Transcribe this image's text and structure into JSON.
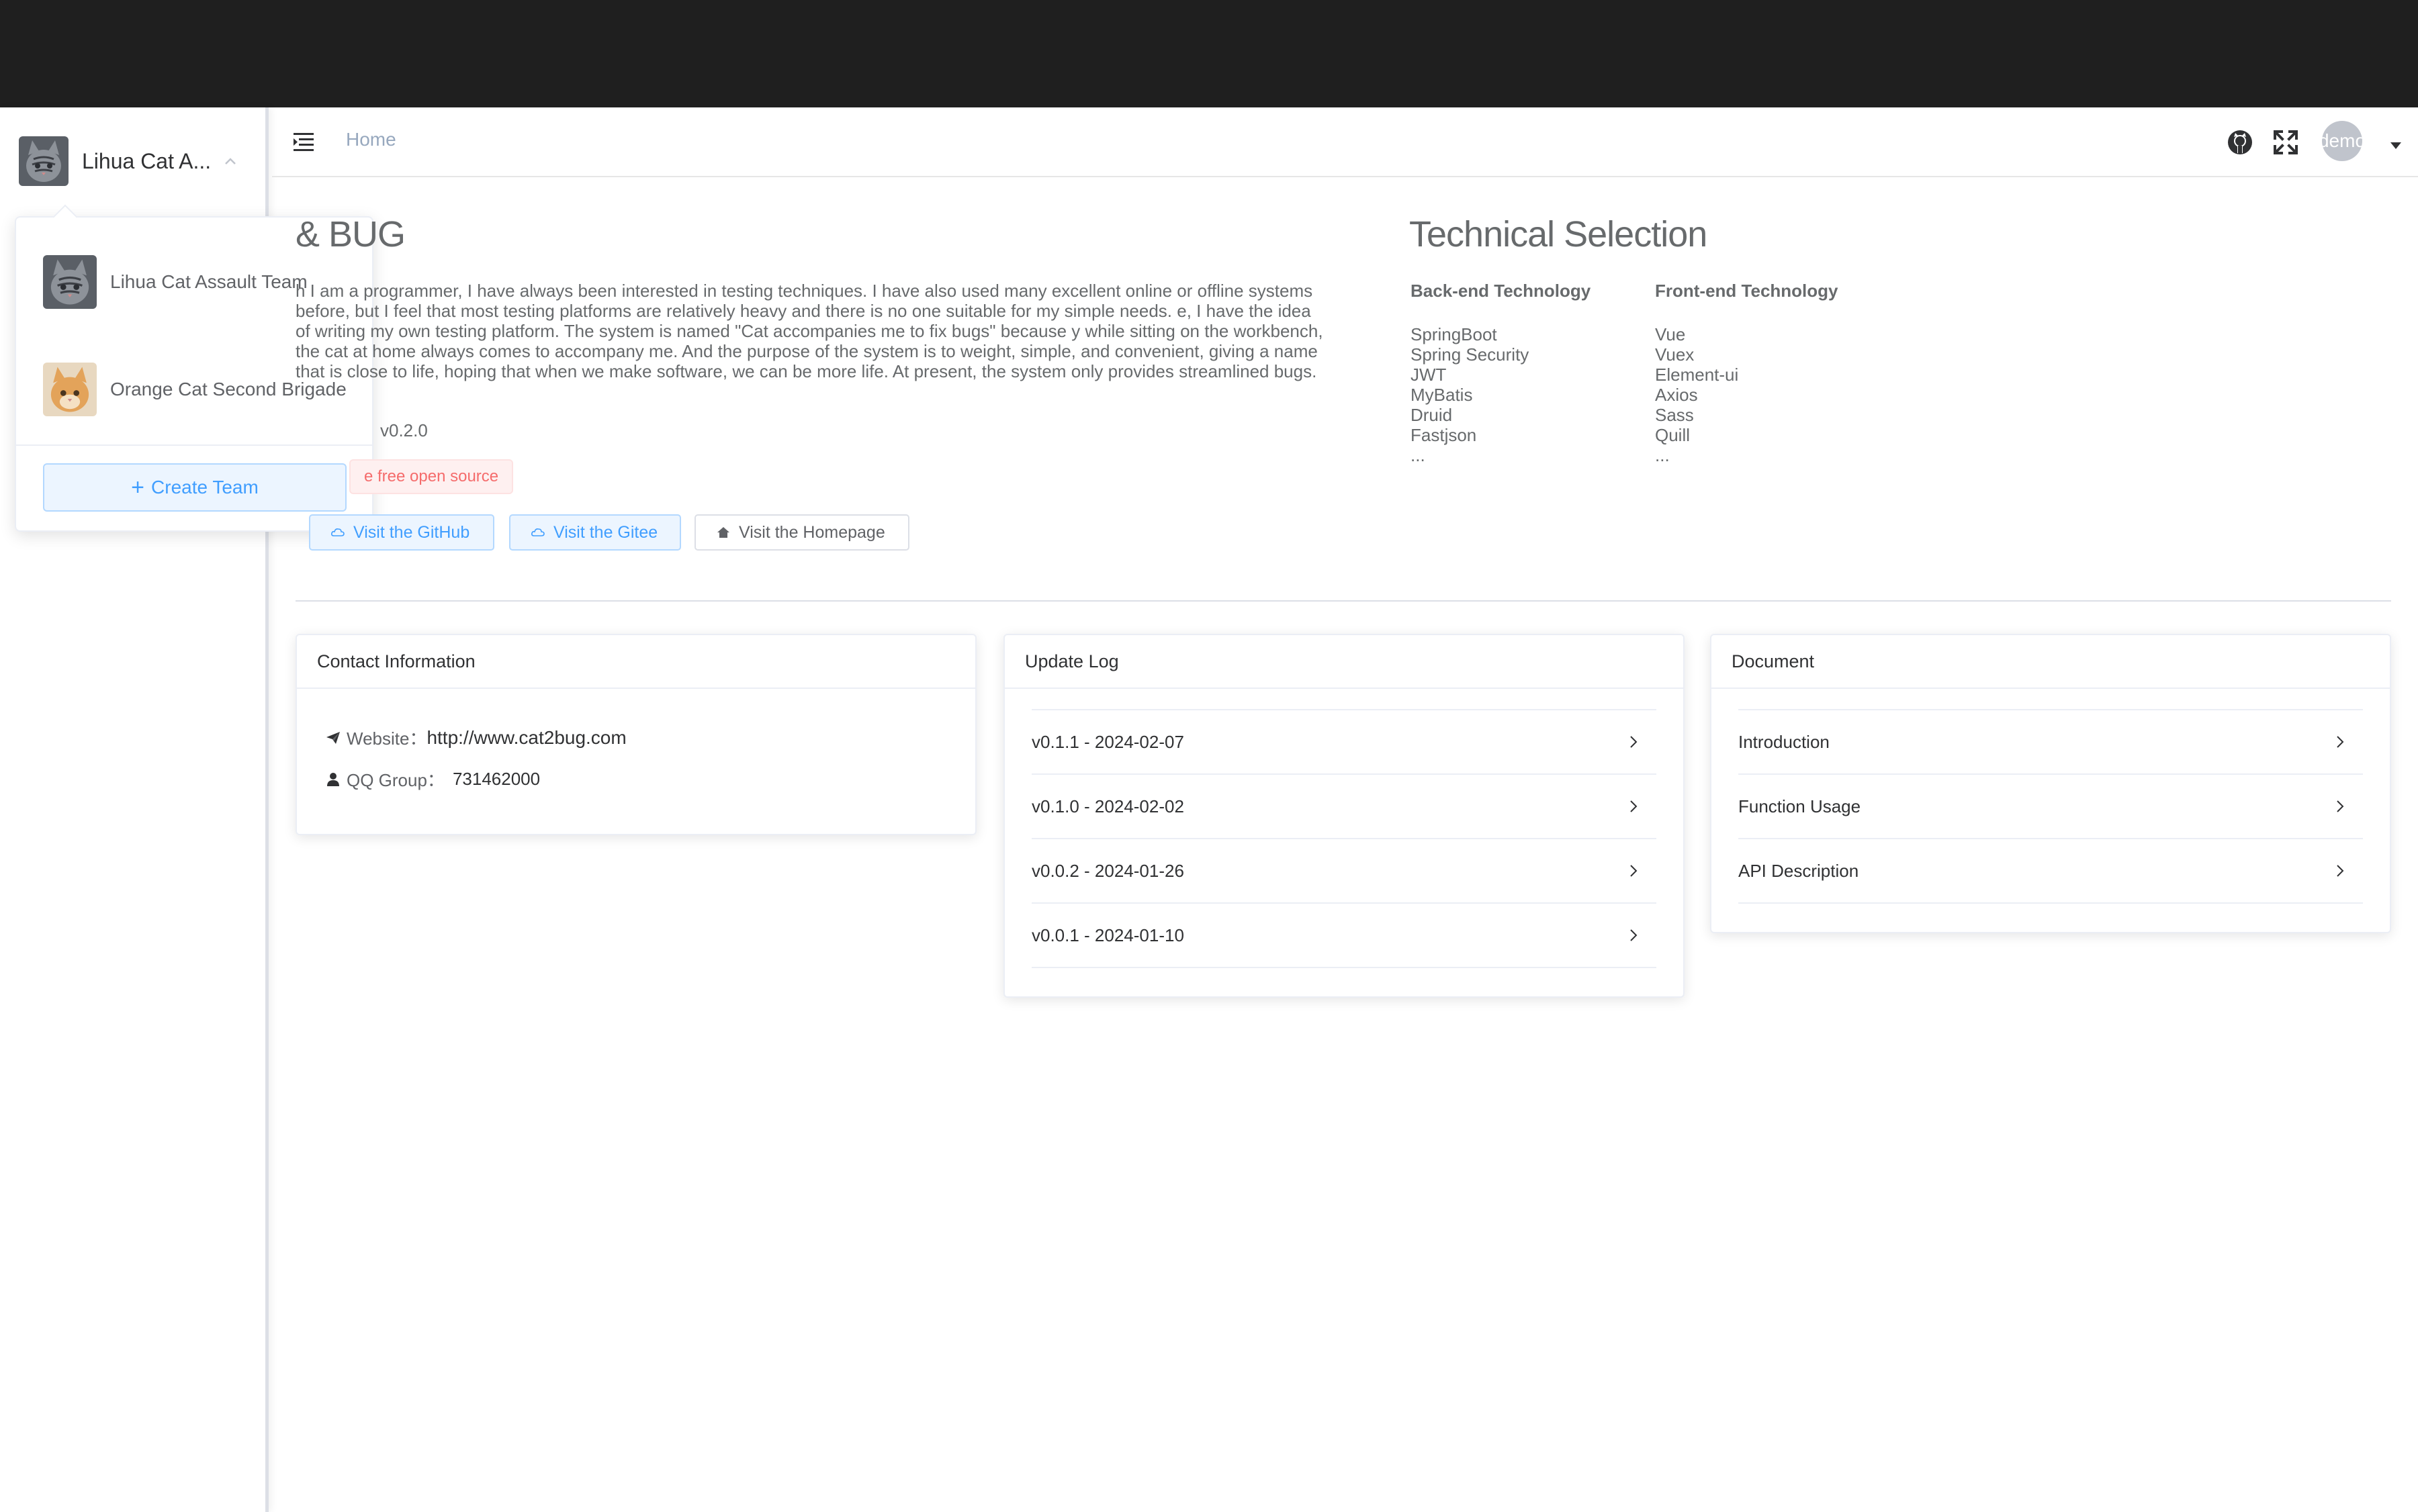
{
  "sidebar": {
    "current_team": "Lihua Cat A...",
    "dropdown": {
      "teams": [
        {
          "name": "Lihua Cat Assault Team",
          "avatar_icon": "tabby-cat-avatar"
        },
        {
          "name": "Orange Cat Second Brigade",
          "avatar_icon": "orange-cat-avatar"
        }
      ],
      "create_label": "Create Team"
    }
  },
  "header": {
    "breadcrumb": "Home",
    "user_avatar_text": "demo"
  },
  "about": {
    "title": "& BUG",
    "paragraph": "h I am a programmer, I have always been interested in testing techniques. I have also used many excellent online or offline systems before, but I feel that most testing platforms are relatively heavy and there is no one suitable for my simple needs. e, I have the idea of writing my own testing platform. The system is named \"Cat accompanies me to fix bugs\" because y while sitting on the workbench, the cat at home always comes to accompany me. And the purpose of the system is to weight, simple, and convenient, giving a name that is close to life, hoping that when we make software, we can be more life. At present, the system only provides streamlined bugs.",
    "version": "v0.2.0",
    "free_tag": "e free open source",
    "buttons": {
      "github": "Visit the GitHub",
      "gitee": "Visit the Gitee",
      "homepage": "Visit the Homepage"
    }
  },
  "tech": {
    "title": "Technical Selection",
    "backend": {
      "heading": "Back-end Technology",
      "items": [
        "SpringBoot",
        "Spring Security",
        "JWT",
        "MyBatis",
        "Druid",
        "Fastjson",
        "..."
      ]
    },
    "frontend": {
      "heading": "Front-end Technology",
      "items": [
        "Vue",
        "Vuex",
        "Element-ui",
        "Axios",
        "Sass",
        "Quill",
        "..."
      ]
    }
  },
  "contact": {
    "title": "Contact Information",
    "website_label": "Website：",
    "website_value": "http://www.cat2bug.com",
    "qq_label": "QQ Group：",
    "qq_value": "731462000"
  },
  "update_log": {
    "title": "Update Log",
    "items": [
      "v0.1.1 - 2024-02-07",
      "v0.1.0 - 2024-02-02",
      "v0.0.2 - 2024-01-26",
      "v0.0.1 - 2024-01-10"
    ]
  },
  "document": {
    "title": "Document",
    "items": [
      "Introduction",
      "Function Usage",
      "API Description"
    ]
  },
  "colors": {
    "primary": "#409eff",
    "danger": "#f56c6c",
    "topbar": "#1f1f1f"
  }
}
